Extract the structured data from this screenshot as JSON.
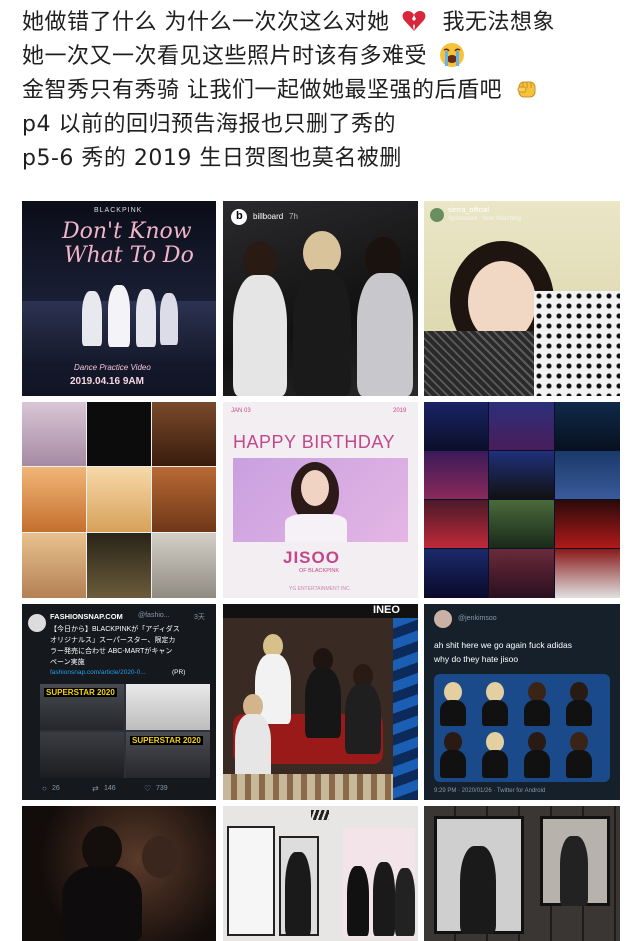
{
  "post": {
    "lines": [
      "她做错了什么 为什么一次次这么对她",
      "我无法想象",
      "她一次又一次看见这些照片时该有多难受",
      "金智秀只有秀骑 让我们一起做她最坚强的后盾吧",
      "p4 以前的回归预告海报也只删了秀的",
      "p5-6 秀的 2019 生日贺图也莫名被删"
    ]
  },
  "images": {
    "p1": {
      "brand": "BLACKPINK",
      "title_line1": "Don't Know",
      "title_line2": "What To Do",
      "subtitle": "Dance Practice Video",
      "date": "2019.04.16 9AM"
    },
    "p2": {
      "account": "billboard",
      "time": "7h"
    },
    "p3": {
      "account": "sierra_official",
      "sponsored": "Sponsored · Now Watching"
    },
    "p5": {
      "date": "JAN 03",
      "year": "2019",
      "heading": "HAPPY BIRTHDAY",
      "name": "JISOO",
      "group": "OF BLACKPINK",
      "credit": "YG ENTERTAINMENT INC."
    },
    "p7": {
      "account": "FASHIONSNAP.COM",
      "handle": "@fashio...",
      "time": "3天",
      "text_line1": "【今日から】BLACKPINKが「アディダス",
      "text_line2": "オリジナルス」スーパースター、限定カ",
      "text_line3": "ラー発売に合わせ ABC-MARTがキャン",
      "text_line4": "ペーン実施",
      "link": "fashionsnap.com/article/2020-0...",
      "pr": "(PR)",
      "banner1": "SUPERSTAR 2020",
      "banner2": "SUPERSTAR 2020",
      "replies": "26",
      "retweets": "146",
      "likes": "739"
    },
    "p8": {
      "logo": "NEO"
    },
    "p9": {
      "handle": "@jenkimsoo",
      "tweet_line1": "ah shit here we go again fuck adidas",
      "tweet_line2": "why do they hate jisoo",
      "footer": "9:29 PM · 2020/01/26 · Twitter for Android"
    }
  },
  "colors": {
    "text": "#1f1f1f",
    "heart": "#d8263c",
    "birthday_pink": "#c2488c",
    "twitter_bg": "#15202b",
    "link_blue": "#1da1f2",
    "superstar_yellow": "#f5d400"
  }
}
